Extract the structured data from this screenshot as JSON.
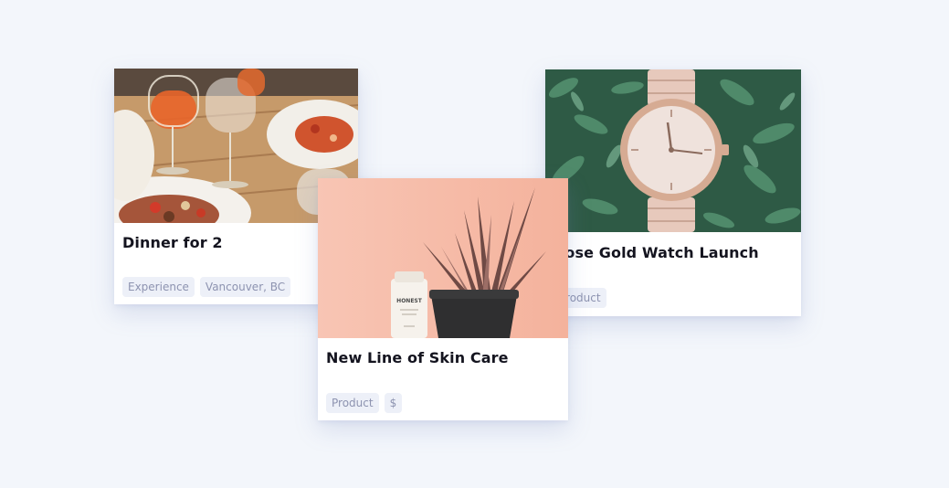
{
  "cards": [
    {
      "image": "dinner-table-photo",
      "title": "Dinner for 2",
      "tags": [
        "Experience",
        "Vancouver, BC"
      ]
    },
    {
      "image": "skin-care-plant-photo",
      "title": "New Line of Skin Care",
      "tags": [
        "Product",
        "$"
      ],
      "image_text": "HONEST"
    },
    {
      "image": "rose-gold-watch-photo",
      "title": "Rose Gold Watch Launch",
      "tags": [
        "Product"
      ]
    }
  ],
  "colors": {
    "background": "#f3f6fb",
    "card": "#ffffff",
    "title": "#14141f",
    "tag_bg": "#edf0f8",
    "tag_text": "#8d93b0",
    "skin_card_photo_bg": "#f6bba8"
  }
}
